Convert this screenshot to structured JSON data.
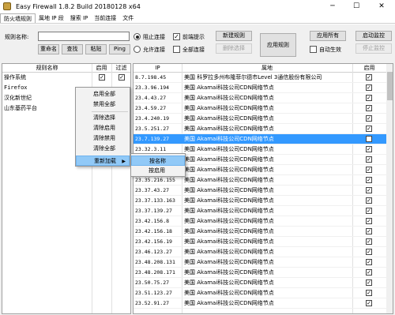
{
  "window": {
    "title": "Easy Firewall 1.8.2 Build 20180128 x64",
    "minimize": "─",
    "maximize": "☐",
    "close": "✕"
  },
  "tabs": [
    "防火墙规则",
    "属地 IP 段",
    "搜索 IP",
    "当前连接",
    "文件"
  ],
  "toolbar": {
    "rule_name_label": "规则名称:",
    "rule_name_value": "",
    "rename": "重命名",
    "find": "查找",
    "paste": "粘贴",
    "ping": "Ping",
    "block_conn": "阻止连接",
    "allow_conn": "允许连接",
    "front_hint": "前端提示",
    "all_conn": "全部连接",
    "new_rule": "新建规则",
    "delete_selected": "删除选择",
    "apply_rule": "应用规则",
    "apply_all": "应用所有",
    "auto_start": "自动生效",
    "start_monitor": "启动监控",
    "stop_monitor": "停止监控",
    "block_checked": true,
    "allow_checked": false,
    "front_hint_checked": true,
    "all_conn_checked": false,
    "auto_start_checked": false
  },
  "rules_grid": {
    "headers": [
      "规则名称",
      "启用",
      "过滤"
    ],
    "rows": [
      {
        "name": "操作系统",
        "enabled": true,
        "filter": true
      },
      {
        "name": "Firefox",
        "enabled": false,
        "filter": false
      },
      {
        "name": "汉化新世纪",
        "enabled": false,
        "filter": false
      },
      {
        "name": "山东基药平台",
        "enabled": false,
        "filter": false
      }
    ]
  },
  "ip_grid": {
    "headers": [
      "IP",
      "属地",
      "启用"
    ],
    "rows": [
      {
        "ip": "8.7.198.45",
        "loc": "美国 科罗拉多州布隆菲尔德市Level 3通信股份有限公司",
        "on": true
      },
      {
        "ip": "23.3.96.194",
        "loc": "美国 Akamai科技公司CDN网络节点",
        "on": true
      },
      {
        "ip": "23.4.43.27",
        "loc": "美国 Akamai科技公司CDN网络节点",
        "on": true
      },
      {
        "ip": "23.4.59.27",
        "loc": "美国 Akamai科技公司CDN网络节点",
        "on": true
      },
      {
        "ip": "23.4.240.19",
        "loc": "美国 Akamai科技公司CDN网络节点",
        "on": true
      },
      {
        "ip": "23.5.251.27",
        "loc": "美国 Akamai科技公司CDN网络节点",
        "on": true
      },
      {
        "ip": "23.7.139.27",
        "loc": "美国 Akamai科技公司CDN网络节点",
        "on": true
      },
      {
        "ip": "23.32.3.11",
        "loc": "美国 Akamai科技公司CDN网络节点",
        "on": true
      },
      {
        "ip": "23.32.",
        "loc": "美国 Akamai科技公司CDN网络节点",
        "on": true
      },
      {
        "ip": "23.3",
        "loc": "美国 Akamai科技公司CDN网络节点",
        "on": true
      },
      {
        "ip": "23.35.216.155",
        "loc": "美国 Akamai科技公司CDN网络节点",
        "on": true
      },
      {
        "ip": "23.37.43.27",
        "loc": "美国 Akamai科技公司CDN网络节点",
        "on": true
      },
      {
        "ip": "23.37.133.163",
        "loc": "美国 Akamai科技公司CDN网络节点",
        "on": true
      },
      {
        "ip": "23.37.139.27",
        "loc": "美国 Akamai科技公司CDN网络节点",
        "on": true
      },
      {
        "ip": "23.42.156.8",
        "loc": "美国 Akamai科技公司CDN网络节点",
        "on": true
      },
      {
        "ip": "23.42.156.18",
        "loc": "美国 Akamai科技公司CDN网络节点",
        "on": true
      },
      {
        "ip": "23.42.156.19",
        "loc": "美国 Akamai科技公司CDN网络节点",
        "on": true
      },
      {
        "ip": "23.46.123.27",
        "loc": "美国 Akamai科技公司CDN网络节点",
        "on": true
      },
      {
        "ip": "23.48.208.131",
        "loc": "美国 Akamai科技公司CDN网络节点",
        "on": true
      },
      {
        "ip": "23.48.208.171",
        "loc": "美国 Akamai科技公司CDN网络节点",
        "on": true
      },
      {
        "ip": "23.50.75.27",
        "loc": "美国 Akamai科技公司CDN网络节点",
        "on": true
      },
      {
        "ip": "23.51.123.27",
        "loc": "美国 Akamai科技公司CDN网络节点",
        "on": true
      },
      {
        "ip": "23.52.91.27",
        "loc": "美国 Akamai科技公司CDN网络节点",
        "on": true
      }
    ]
  },
  "context_menu": {
    "items": [
      "启用全部",
      "禁用全部",
      "清除选择",
      "清除启用",
      "清除禁用",
      "清除全部",
      "重新加载"
    ],
    "arrow": "▶"
  },
  "submenu": {
    "items": [
      "按名称",
      "按启用"
    ]
  }
}
